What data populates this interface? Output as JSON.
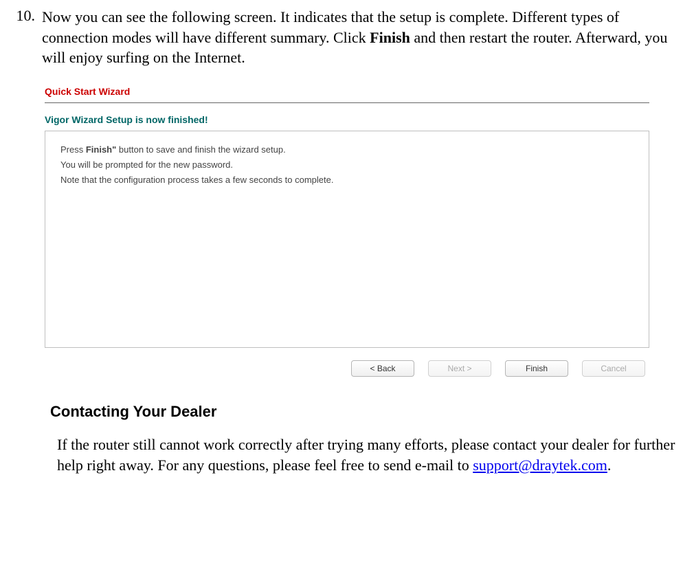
{
  "step": {
    "number": "10.",
    "text_prefix": "Now you can see the following screen. It indicates that the setup is complete. Different types of connection modes will have different summary. Click ",
    "bold_word": "Finish",
    "text_suffix": " and then restart the router. Afterward, you will enjoy surfing on the Internet."
  },
  "wizard": {
    "title": "Quick Start Wizard",
    "subtitle": "Vigor Wizard Setup is now finished!",
    "panel_line1_prefix": "Press ",
    "panel_line1_bold": "Finish\"",
    "panel_line1_suffix": " button to save and finish the wizard setup.",
    "panel_line2": "You will be prompted for the new password.",
    "panel_line3": "Note that the configuration process takes a few seconds to complete.",
    "buttons": {
      "back": "< Back",
      "next": "Next >",
      "finish": "Finish",
      "cancel": "Cancel"
    }
  },
  "contacting": {
    "heading": "Contacting Your Dealer",
    "text_prefix": "If the router still cannot work correctly after trying many efforts, please contact your dealer for further help right away. For any questions, please feel free to send e-mail to ",
    "email": "support@draytek.com",
    "text_suffix": "."
  }
}
